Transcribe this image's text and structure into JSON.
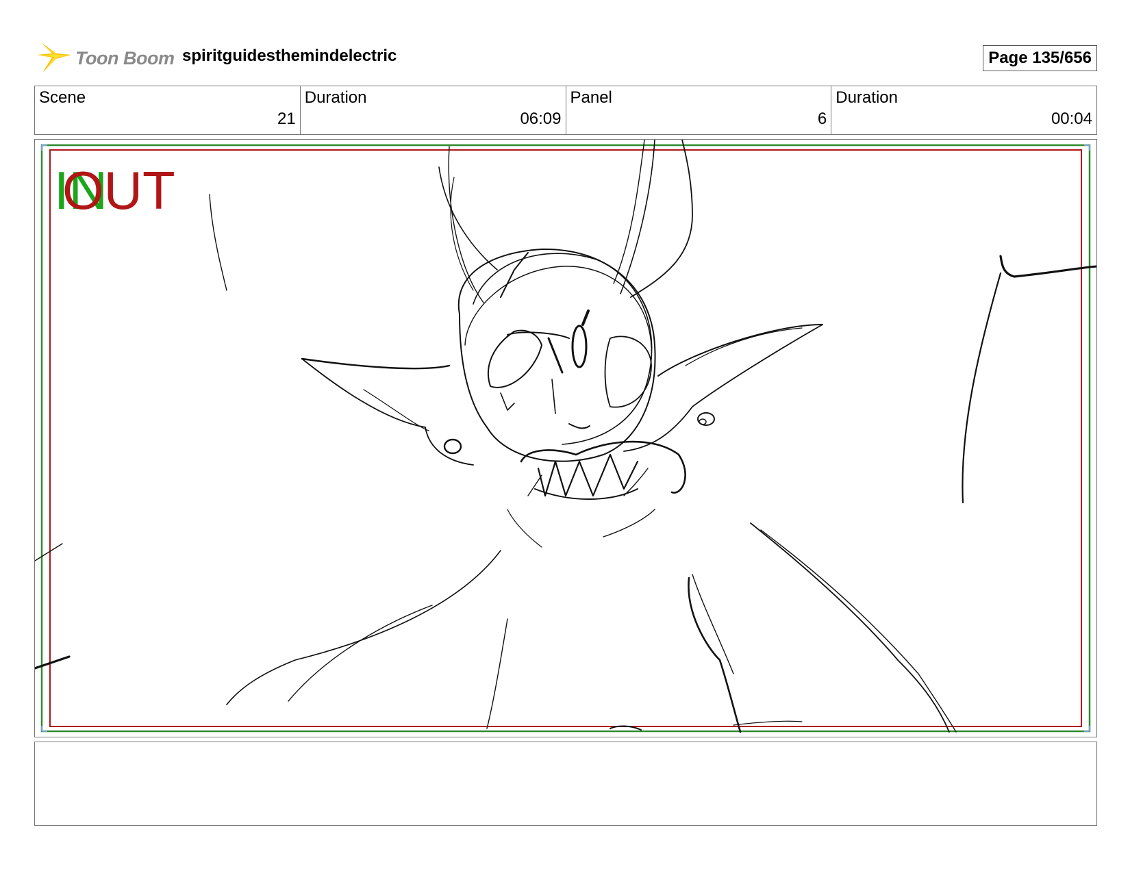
{
  "header": {
    "logo_text": "Toon Boom",
    "project_title": "spiritguidesthemindelectric",
    "page_label": "Page 135/656"
  },
  "info": {
    "scene_label": "Scene",
    "scene_value": "21",
    "scene_duration_label": "Duration",
    "scene_duration_value": "06:09",
    "panel_label": "Panel",
    "panel_value": "6",
    "panel_duration_label": "Duration",
    "panel_duration_value": "00:04"
  },
  "panel": {
    "in_marker": "IN",
    "out_marker": "OUT",
    "in_color": "#1aa51a",
    "out_color": "#b11616"
  },
  "notes": {
    "text": ""
  },
  "colors": {
    "safe_frame_green": "#2e8b2e",
    "safe_frame_red": "#b11616",
    "border": "#777777",
    "logo_text": "#8a8a8a",
    "logo_burst": "#f5c400"
  }
}
